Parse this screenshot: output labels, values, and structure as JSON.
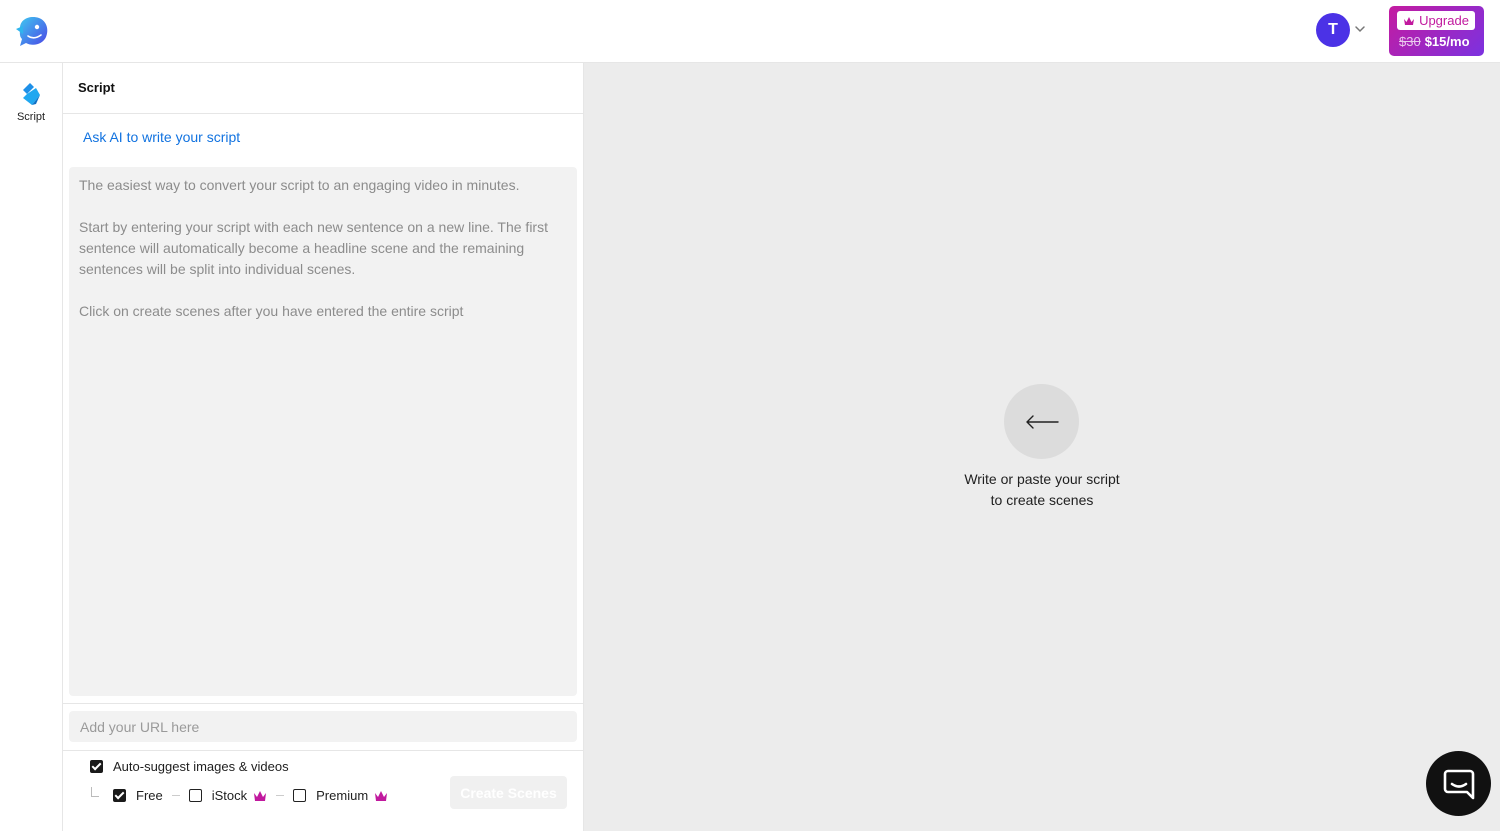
{
  "header": {
    "logo_icon": "fish-logo-icon",
    "avatar_initial": "T",
    "upgrade": {
      "label": "Upgrade",
      "old_price": "$30",
      "new_price": "$15/mo",
      "icon": "crown-icon"
    }
  },
  "rail": {
    "items": [
      {
        "label": "Script",
        "icon": "script-pen-icon",
        "active": true
      }
    ]
  },
  "panel": {
    "title": "Script",
    "ask_ai": "Ask AI to write your script",
    "script_placeholder": [
      "The easiest way to convert your script to an engaging video in minutes.",
      "Start by entering your script with each new sentence on a new line. The first sentence will automatically become a headline scene and the remaining sentences will be split into individual scenes.",
      "Click on create scenes after you have entered the entire script"
    ],
    "url_placeholder": "Add your URL here",
    "auto_suggest": {
      "label": "Auto-suggest images & videos",
      "checked": true
    },
    "sources": [
      {
        "label": "Free",
        "checked": true,
        "premium": false
      },
      {
        "label": "iStock",
        "checked": false,
        "premium": true
      },
      {
        "label": "Premium",
        "checked": false,
        "premium": true
      }
    ],
    "create_button": "Create Scenes"
  },
  "canvas": {
    "hint_line1": "Write or paste your script",
    "hint_line2": "to create scenes",
    "back_icon": "arrow-left-icon"
  },
  "chat": {
    "icon": "chat-bubble-icon"
  },
  "colors": {
    "accent_blue": "#1273e0",
    "avatar": "#4b32e6",
    "upgrade_gradient_start": "#c41ba0",
    "upgrade_gradient_end": "#7b32e0",
    "crown": "#c1199e"
  }
}
